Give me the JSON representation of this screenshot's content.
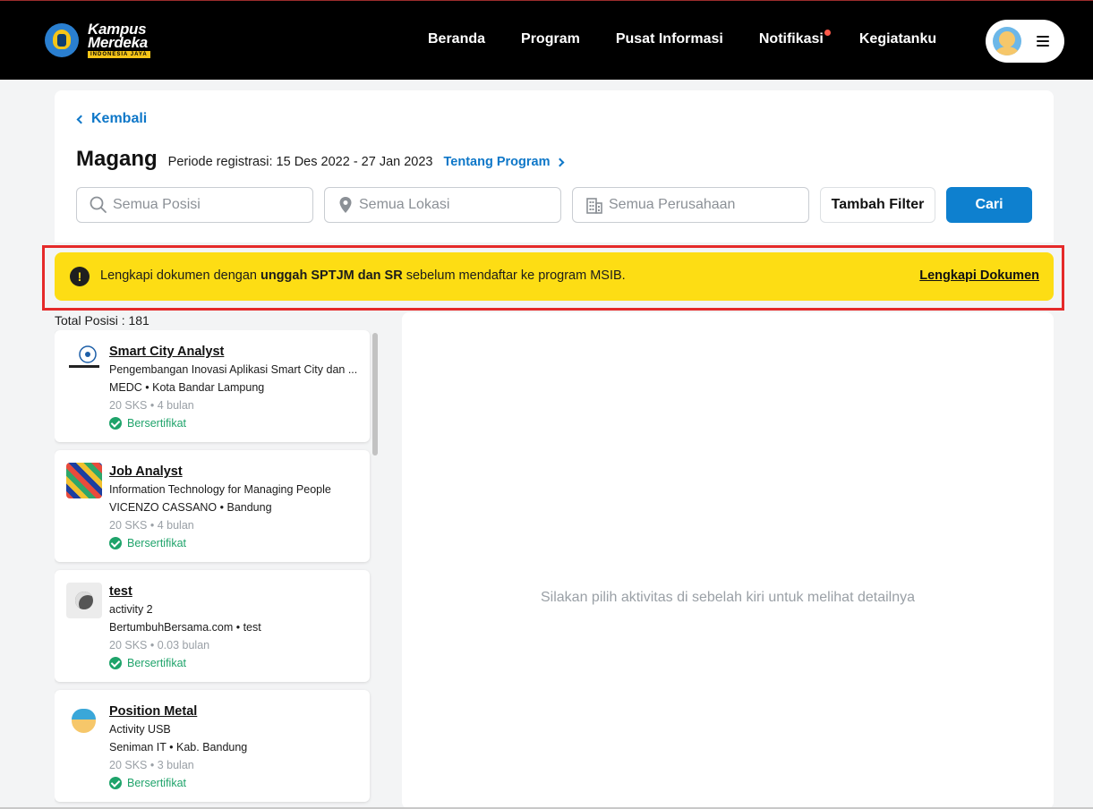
{
  "nav": {
    "logo_line1": "Kampus",
    "logo_line2": "Merdeka",
    "logo_tag": "INDONESIA JAYA",
    "links": [
      "Beranda",
      "Program",
      "Pusat Informasi",
      "Notifikasi",
      "Kegiatanku"
    ],
    "notif_dot_color": "#ff5a4a"
  },
  "header": {
    "back_label": "Kembali",
    "title": "Magang",
    "periode": "Periode registrasi: 15 Des 2022 - 27 Jan 2023",
    "tentang_label": "Tentang Program"
  },
  "search": {
    "posisi_placeholder": "Semua Posisi",
    "lokasi_placeholder": "Semua Lokasi",
    "perusahaan_placeholder": "Semua Perusahaan",
    "filter_label": "Tambah Filter",
    "cari_label": "Cari"
  },
  "alert": {
    "icon": "!",
    "text_before": "Lengkapi dokumen dengan ",
    "text_bold": "unggah SPTJM dan SR",
    "text_after": " sebelum mendaftar ke program MSIB.",
    "link_label": "Lengkapi Dokumen",
    "bg_color": "#fddd14"
  },
  "results": {
    "total_label": "Total Posisi : 181",
    "items": [
      {
        "title": "Smart City Analyst",
        "subtitle": "Pengembangan Inovasi Aplikasi Smart City dan ...",
        "company": "MEDC • Kota Bandar Lampung",
        "meta": "20 SKS • 4 bulan",
        "cert": "Bersertifikat"
      },
      {
        "title": "Job Analyst",
        "subtitle": "Information Technology for Managing People",
        "company": "VICENZO CASSANO • Bandung",
        "meta": "20 SKS • 4 bulan",
        "cert": "Bersertifikat"
      },
      {
        "title": "test",
        "subtitle": "activity 2",
        "company": "BertumbuhBersama.com • test",
        "meta": "20 SKS • 0.03 bulan",
        "cert": "Bersertifikat"
      },
      {
        "title": "Position Metal",
        "subtitle": "Activity USB",
        "company": "Seniman IT • Kab. Bandung",
        "meta": "20 SKS • 3 bulan",
        "cert": "Bersertifikat"
      }
    ]
  },
  "detail": {
    "empty_text": "Silakan pilih aktivitas di sebelah kiri untuk melihat detailnya"
  }
}
